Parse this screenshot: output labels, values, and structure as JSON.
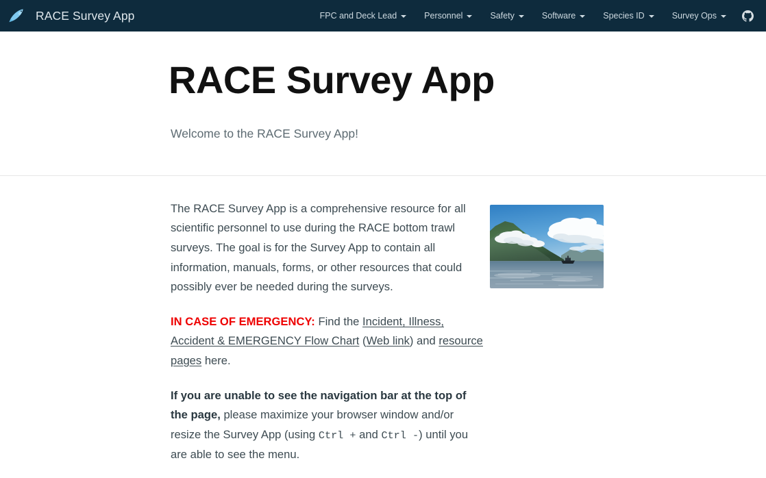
{
  "navbar": {
    "brand_title": "RACE Survey App",
    "brand_logo_icon": "fish-icon",
    "items": [
      {
        "label": "FPC and Deck Lead",
        "has_caret": true
      },
      {
        "label": "Personnel",
        "has_caret": true
      },
      {
        "label": "Safety",
        "has_caret": true
      },
      {
        "label": "Software",
        "has_caret": true
      },
      {
        "label": "Species ID",
        "has_caret": true
      },
      {
        "label": "Survey Ops",
        "has_caret": true
      }
    ],
    "github_icon": "github-icon"
  },
  "hero": {
    "title": "RACE Survey App",
    "subtitle": "Welcome to the RACE Survey App!"
  },
  "main": {
    "intro_paragraph": "The RACE Survey App is a comprehensive resource for all scientific personnel to use during the RACE bottom trawl surveys. The goal is for the Survey App to contain all information, manuals, forms, or other resources that could possibly ever be needed during the surveys.",
    "emergency": {
      "label": "IN CASE OF EMERGENCY:",
      "text_before_link": " Find the ",
      "link_flowchart": "Incident, Illness, Accident & EMERGENCY Flow Chart",
      "open_paren": " (",
      "link_weblink": "Web link",
      "close_paren": ") and ",
      "link_resources": "resource pages",
      "text_after": " here."
    },
    "navhelp": {
      "bold_lead": "If you are unable to see the navigation bar at the top of the page,",
      "text_1": " please maximize your browser window and/or resize the Survey App (using ",
      "kbd_1": "Ctrl +",
      "text_2": " and ",
      "kbd_2": "Ctrl -",
      "text_3": ") until you are able to see the menu."
    },
    "photo_alt": "coastal-mountain-photo"
  },
  "colors": {
    "navbar_bg": "#0e2b3d",
    "emergency_red": "#ee0000",
    "body_text": "#3d4b52",
    "subtitle_text": "#5d6b72",
    "brand_text": "#dfe7ec"
  }
}
